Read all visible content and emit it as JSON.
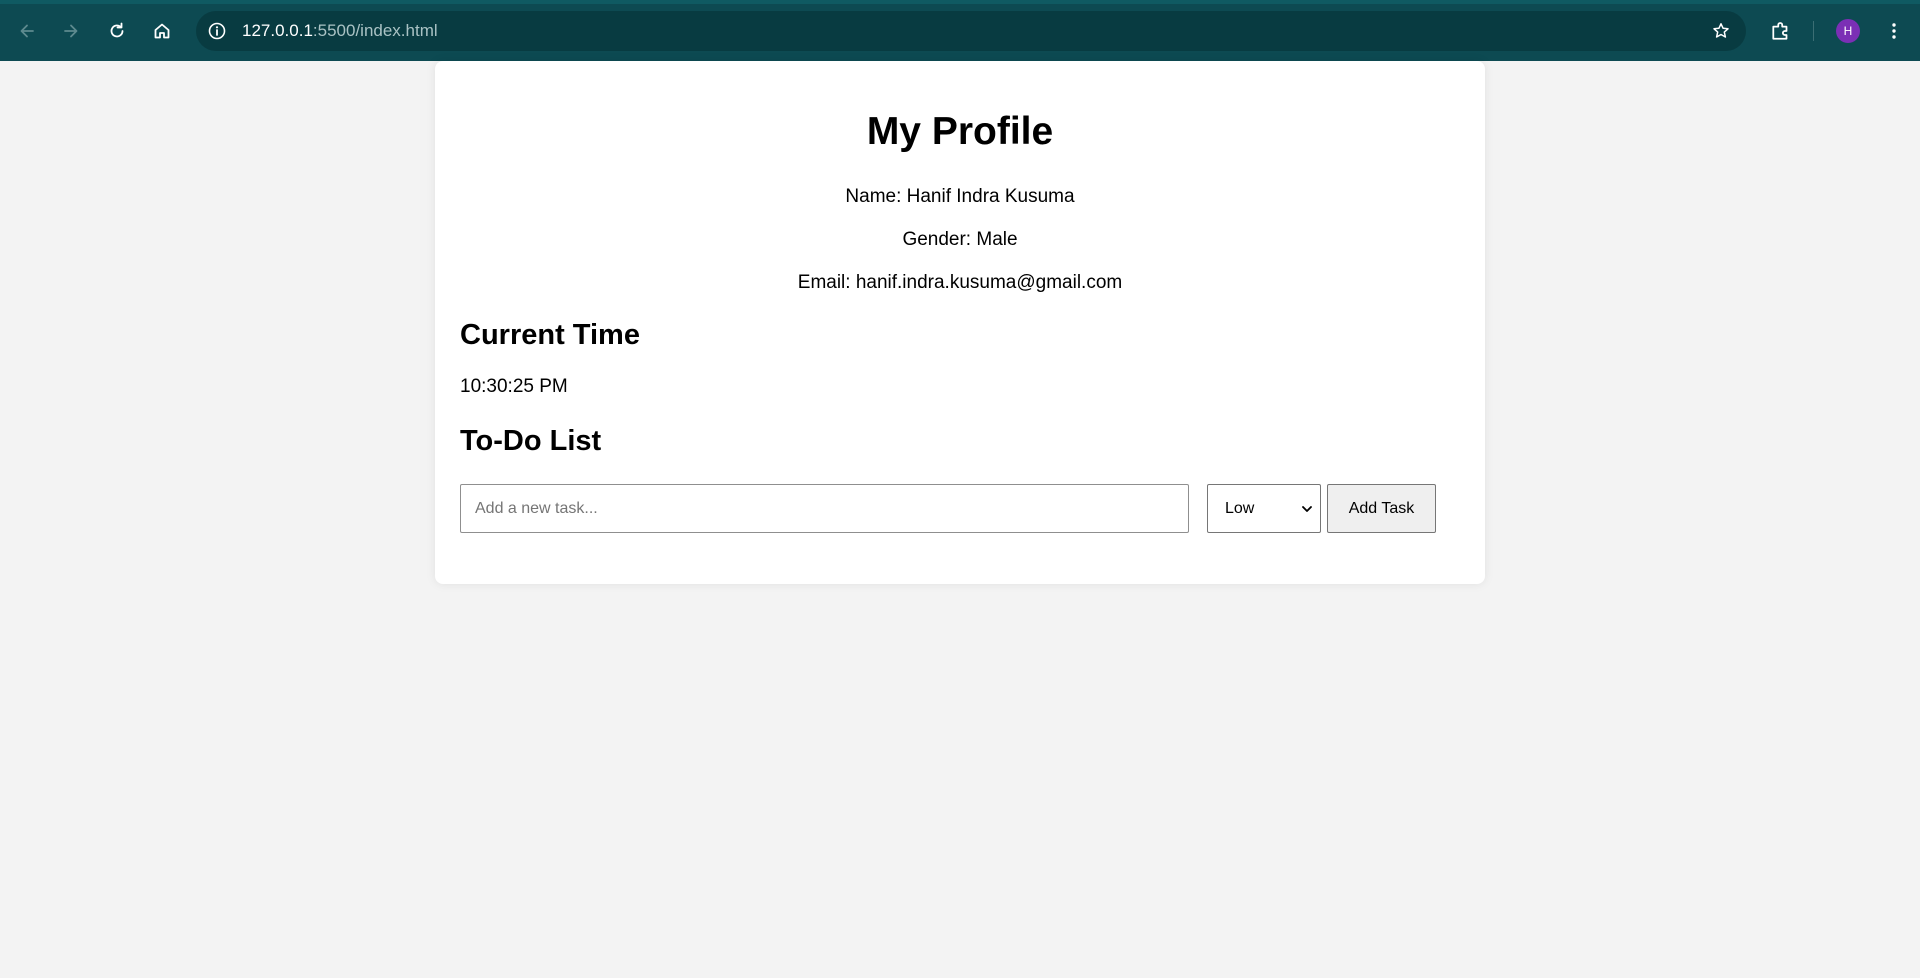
{
  "browser": {
    "url_host": "127.0.0.1",
    "url_path": ":5500/index.html",
    "avatar_initial": "H",
    "icons": {
      "back": "arrow-left-icon",
      "forward": "arrow-right-icon",
      "reload": "reload-icon",
      "home": "home-icon",
      "info": "info-icon",
      "bookmark": "star-icon",
      "extensions": "puzzle-icon",
      "menu": "kebab-menu-icon"
    },
    "colors": {
      "toolbar": "#0d4a52",
      "omnibox": "#083b41",
      "avatar": "#7b2fb5"
    }
  },
  "profile": {
    "title": "My Profile",
    "name_line": "Name: Hanif Indra Kusuma",
    "gender_line": "Gender: Male",
    "email_line": "Email: hanif.indra.kusuma@gmail.com"
  },
  "time_section": {
    "heading": "Current Time",
    "time": "10:30:25 PM"
  },
  "todo": {
    "heading": "To-Do List",
    "input_placeholder": "Add a new task...",
    "input_value": "",
    "priority_selected": "Low",
    "add_button_label": "Add Task"
  }
}
